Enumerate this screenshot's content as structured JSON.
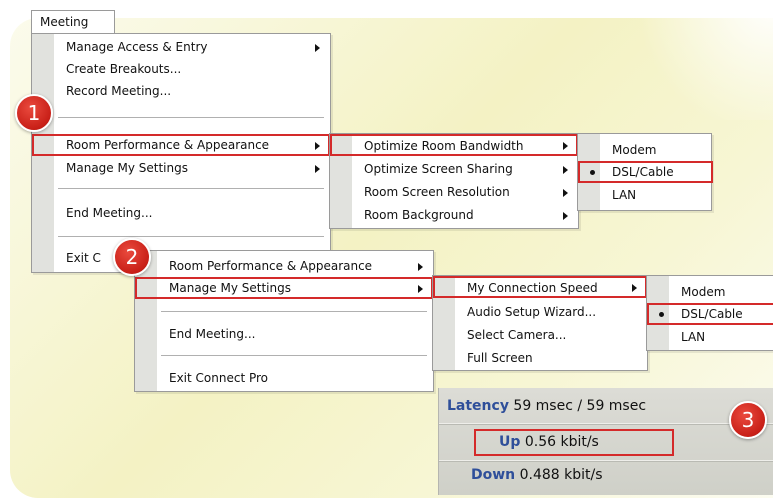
{
  "menubar": {
    "tab_label": "Meeting"
  },
  "menu1": {
    "items": [
      {
        "label": "Manage Access & Entry"
      },
      {
        "label": "Create Breakouts..."
      },
      {
        "label": "Record Meeting..."
      },
      {
        "label": "Room Performance & Appearance"
      },
      {
        "label": "Manage My Settings"
      },
      {
        "label": "End Meeting..."
      },
      {
        "label": "Exit C"
      }
    ]
  },
  "submenu_room": {
    "items": [
      {
        "label": "Optimize Room Bandwidth"
      },
      {
        "label": "Optimize Screen Sharing"
      },
      {
        "label": "Room Screen Resolution"
      },
      {
        "label": "Room Background"
      }
    ]
  },
  "submenu_bandwidth": {
    "items": [
      {
        "label": "Modem"
      },
      {
        "label": "DSL/Cable"
      },
      {
        "label": "LAN"
      }
    ]
  },
  "menu2": {
    "items": [
      {
        "label": "Room Performance & Appearance"
      },
      {
        "label": "Manage My Settings"
      },
      {
        "label": "End Meeting..."
      },
      {
        "label": "Exit Connect Pro"
      }
    ]
  },
  "submenu_settings": {
    "items": [
      {
        "label": "My Connection Speed"
      },
      {
        "label": "Audio Setup Wizard..."
      },
      {
        "label": "Select Camera..."
      },
      {
        "label": "Full Screen"
      }
    ]
  },
  "submenu_speed": {
    "items": [
      {
        "label": "Modem"
      },
      {
        "label": "DSL/Cable"
      },
      {
        "label": "LAN"
      }
    ]
  },
  "badges": [
    "1",
    "2",
    "3"
  ],
  "status": {
    "latency_key": "Latency",
    "latency_value": "59 msec / 59 msec",
    "up_key": "Up",
    "up_value": "0.56 kbit/s",
    "down_key": "Down",
    "down_value": "0.488 kbit/s"
  },
  "colors": {
    "highlight": "#d42a2a",
    "badge": "#d12a20",
    "status_key": "#2f4f9a"
  }
}
